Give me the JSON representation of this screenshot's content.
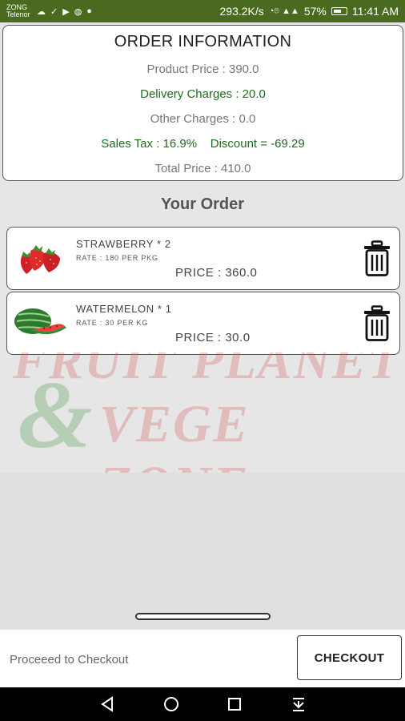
{
  "status_bar": {
    "carrier_1": "ZONG",
    "carrier_2": "Telenor",
    "network_speed": "293.2K/s",
    "battery": "57%",
    "time": "11:41 AM"
  },
  "order_information": {
    "title": "ORDER INFORMATION",
    "product_price": "Product Price : 390.0",
    "delivery_charges": "Delivery Charges : 20.0",
    "other_charges": "Other Charges : 0.0",
    "sales_tax": "Sales Tax : 16.9%",
    "discount": "Discount = -69.29",
    "total_price": "Total Price : 410.0"
  },
  "your_order_heading": "Your Order",
  "items": [
    {
      "name": "STRAWBERRY  * 2",
      "rate": "RATE : 180  PER  PKG",
      "price": "PRICE : 360.0",
      "image": "strawberry-image"
    },
    {
      "name": "WATERMELON  * 1",
      "rate": "RATE : 30  PER  KG",
      "price": "PRICE : 30.0",
      "image": "watermelon-image"
    }
  ],
  "watermark": {
    "line1": "FRUIT PLANET",
    "ampersand": "&",
    "line2": "VEGE ZONE"
  },
  "checkout_bar": {
    "proceed_text": "Proceeed to Checkout",
    "checkout_label": "CHECKOUT"
  },
  "colors": {
    "status_bar": "#4a6b1f",
    "green_text": "#1f6b1f"
  },
  "icons": [
    "trash-icon",
    "back-icon",
    "home-icon",
    "recents-icon",
    "notification-pull-icon"
  ]
}
